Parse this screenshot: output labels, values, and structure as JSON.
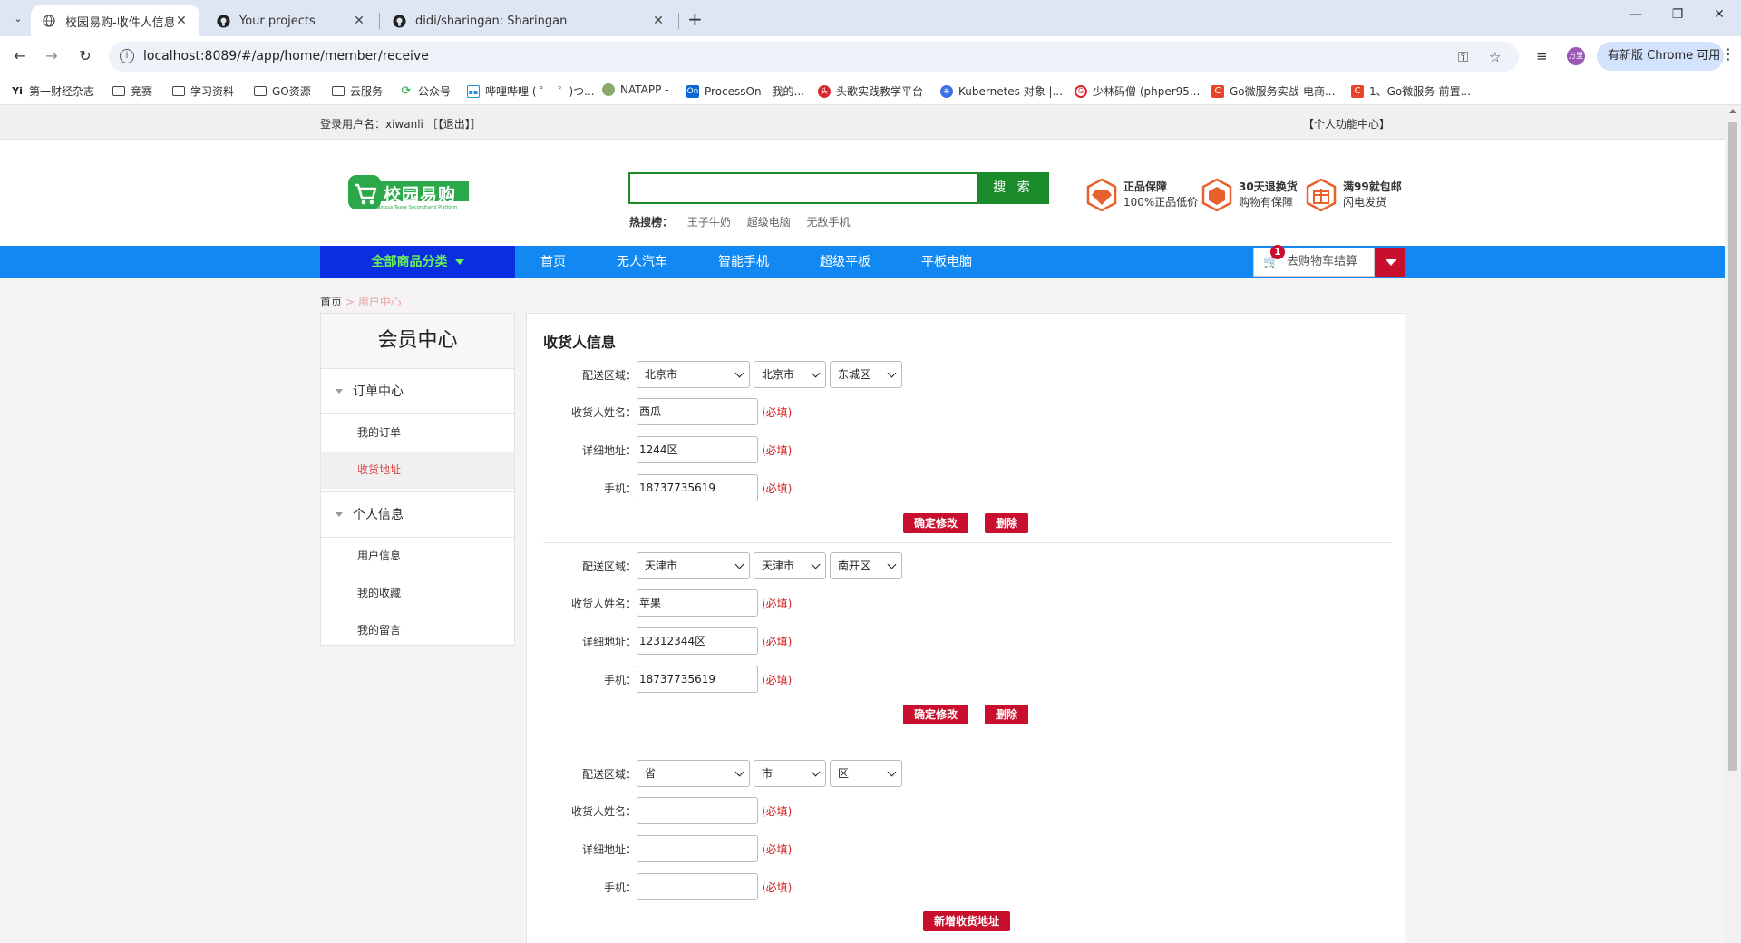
{
  "browser": {
    "tabs": [
      {
        "title": "校园易购-收件人信息",
        "active": true
      },
      {
        "title": "Your projects",
        "active": false
      },
      {
        "title": "didi/sharingan: Sharingan",
        "active": false
      }
    ],
    "url": "localhost:8089/#/app/home/member/receive",
    "profile_label": "万里",
    "update_label": "有新版 Chrome 可用",
    "bookmarks": [
      "第一财经杂志",
      "竞赛",
      "学习资料",
      "GO资源",
      "云服务",
      "公众号",
      "哔哩哔哩 ( ゜- ゜)つ...",
      "NATAPP -",
      "ProcessOn - 我的...",
      "头歌实践教学平台",
      "Kubernetes 对象 |...",
      "少林码僧 (phper95...",
      "Go微服务实战-电商...",
      "1、Go微服务-前置..."
    ]
  },
  "topbar": {
    "login_text": "登录用户名：xiwanli ［【退出】］",
    "center_text": "【个人功能中心】"
  },
  "header": {
    "logo_main": "校园易购",
    "logo_sub": "Campus Tease Secondhand Platform",
    "search_placeholder": "",
    "search_button": "搜 索",
    "hot_label": "热搜榜：",
    "hot_keywords": [
      "王子牛奶",
      "超级电脑",
      "无敌手机"
    ],
    "promos": [
      {
        "title": "正品保障",
        "sub": "100%正品低价"
      },
      {
        "title": "30天退换货",
        "sub": "购物有保障"
      },
      {
        "title": "满99就包邮",
        "sub": "闪电发货"
      }
    ]
  },
  "nav": {
    "all_categories": "全部商品分类",
    "items": [
      "首页",
      "无人汽车",
      "智能手机",
      "超级平板",
      "平板电脑"
    ],
    "cart_label": "去购物车结算",
    "cart_count": "1"
  },
  "breadcrumb": {
    "home": "首页",
    "sep": " > ",
    "current": "用户中心"
  },
  "sidebar": {
    "title": "会员中心",
    "groups": [
      {
        "label": "订单中心",
        "items": [
          "我的订单",
          "收货地址"
        ]
      },
      {
        "label": "个人信息",
        "items": [
          "用户信息",
          "我的收藏",
          "我的留言"
        ]
      }
    ]
  },
  "main": {
    "title": "收货人信息",
    "labels": {
      "region": "配送区域：",
      "name": "收货人姓名：",
      "address": "详细地址：",
      "phone": "手机："
    },
    "required": "(必填)",
    "confirm_button": "确定修改",
    "delete_button": "删除",
    "add_button": "新增收货地址",
    "addresses": [
      {
        "province": "北京市",
        "city": "北京市",
        "district": "东城区",
        "name": "西瓜",
        "address": "1244区",
        "phone": "18737735619"
      },
      {
        "province": "天津市",
        "city": "天津市",
        "district": "南开区",
        "name": "苹果",
        "address": "12312344区",
        "phone": "18737735619"
      }
    ],
    "new_address": {
      "province": "省",
      "city": "市",
      "district": "区",
      "name": "",
      "address": "",
      "phone": ""
    }
  },
  "colors": {
    "nav_blue": "#1289f2",
    "category_blue": "#0a2ee0",
    "brand_green": "#1a8a2a",
    "button_red": "#c8102e",
    "required_red": "#d02020"
  }
}
